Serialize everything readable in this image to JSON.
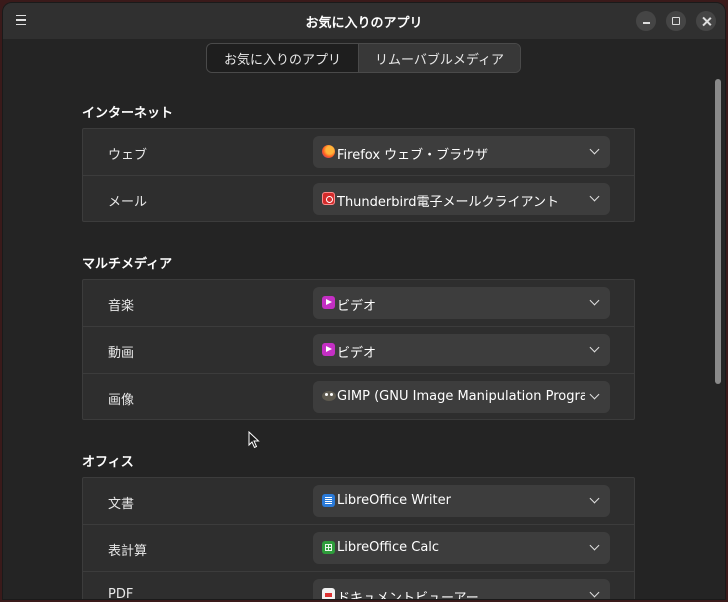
{
  "window": {
    "title": "お気に入りのアプリ"
  },
  "tabs": [
    {
      "label": "お気に入りのアプリ",
      "active": true
    },
    {
      "label": "リムーバブルメディア",
      "active": false
    }
  ],
  "sections": {
    "internet": {
      "title": "インターネット",
      "rows": [
        {
          "label": "ウェブ",
          "value": "Firefox ウェブ・ブラウザ",
          "icon": "firefox-icon"
        },
        {
          "label": "メール",
          "value": "Thunderbird電子メールクライアント",
          "icon": "thunderbird-icon"
        }
      ]
    },
    "multimedia": {
      "title": "マルチメディア",
      "rows": [
        {
          "label": "音楽",
          "value": "ビデオ",
          "icon": "video-icon"
        },
        {
          "label": "動画",
          "value": "ビデオ",
          "icon": "video-icon"
        },
        {
          "label": "画像",
          "value": "GIMP (GNU Image Manipulation Program)",
          "icon": "gimp-icon"
        }
      ]
    },
    "office": {
      "title": "オフィス",
      "rows": [
        {
          "label": "文書",
          "value": "LibreOffice Writer",
          "icon": "libreoffice-writer-icon"
        },
        {
          "label": "表計算",
          "value": "LibreOffice Calc",
          "icon": "libreoffice-calc-icon"
        },
        {
          "label": "PDF",
          "value": "ドキュメントビューアー",
          "icon": "document-viewer-icon"
        }
      ]
    }
  },
  "colors": {
    "window_bg": "#242424",
    "titlebar_bg": "#303030",
    "group_bg": "#2e2e2e",
    "dropdown_bg": "#3d3d3d"
  }
}
